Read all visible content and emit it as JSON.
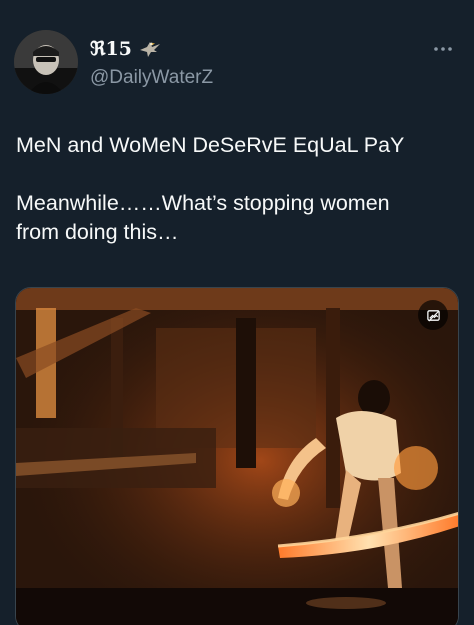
{
  "author": {
    "display_name": "ℜ15",
    "handle": "@DailyWaterZ",
    "badge_icon": "eagle-icon",
    "avatar_icon": "profile-avatar"
  },
  "tweet": {
    "line1": "MeN and WoMeN DeSeRvE EqUaL PaY",
    "line2": "Meanwhile……What’s stopping women",
    "line3": "from doing this…"
  },
  "media": {
    "type": "video",
    "description_icon": "media-settings-icon"
  },
  "colors": {
    "background": "#15202b",
    "text": "#f7f9f9",
    "secondary": "#8b98a5",
    "fire": "#ff7a2a"
  }
}
